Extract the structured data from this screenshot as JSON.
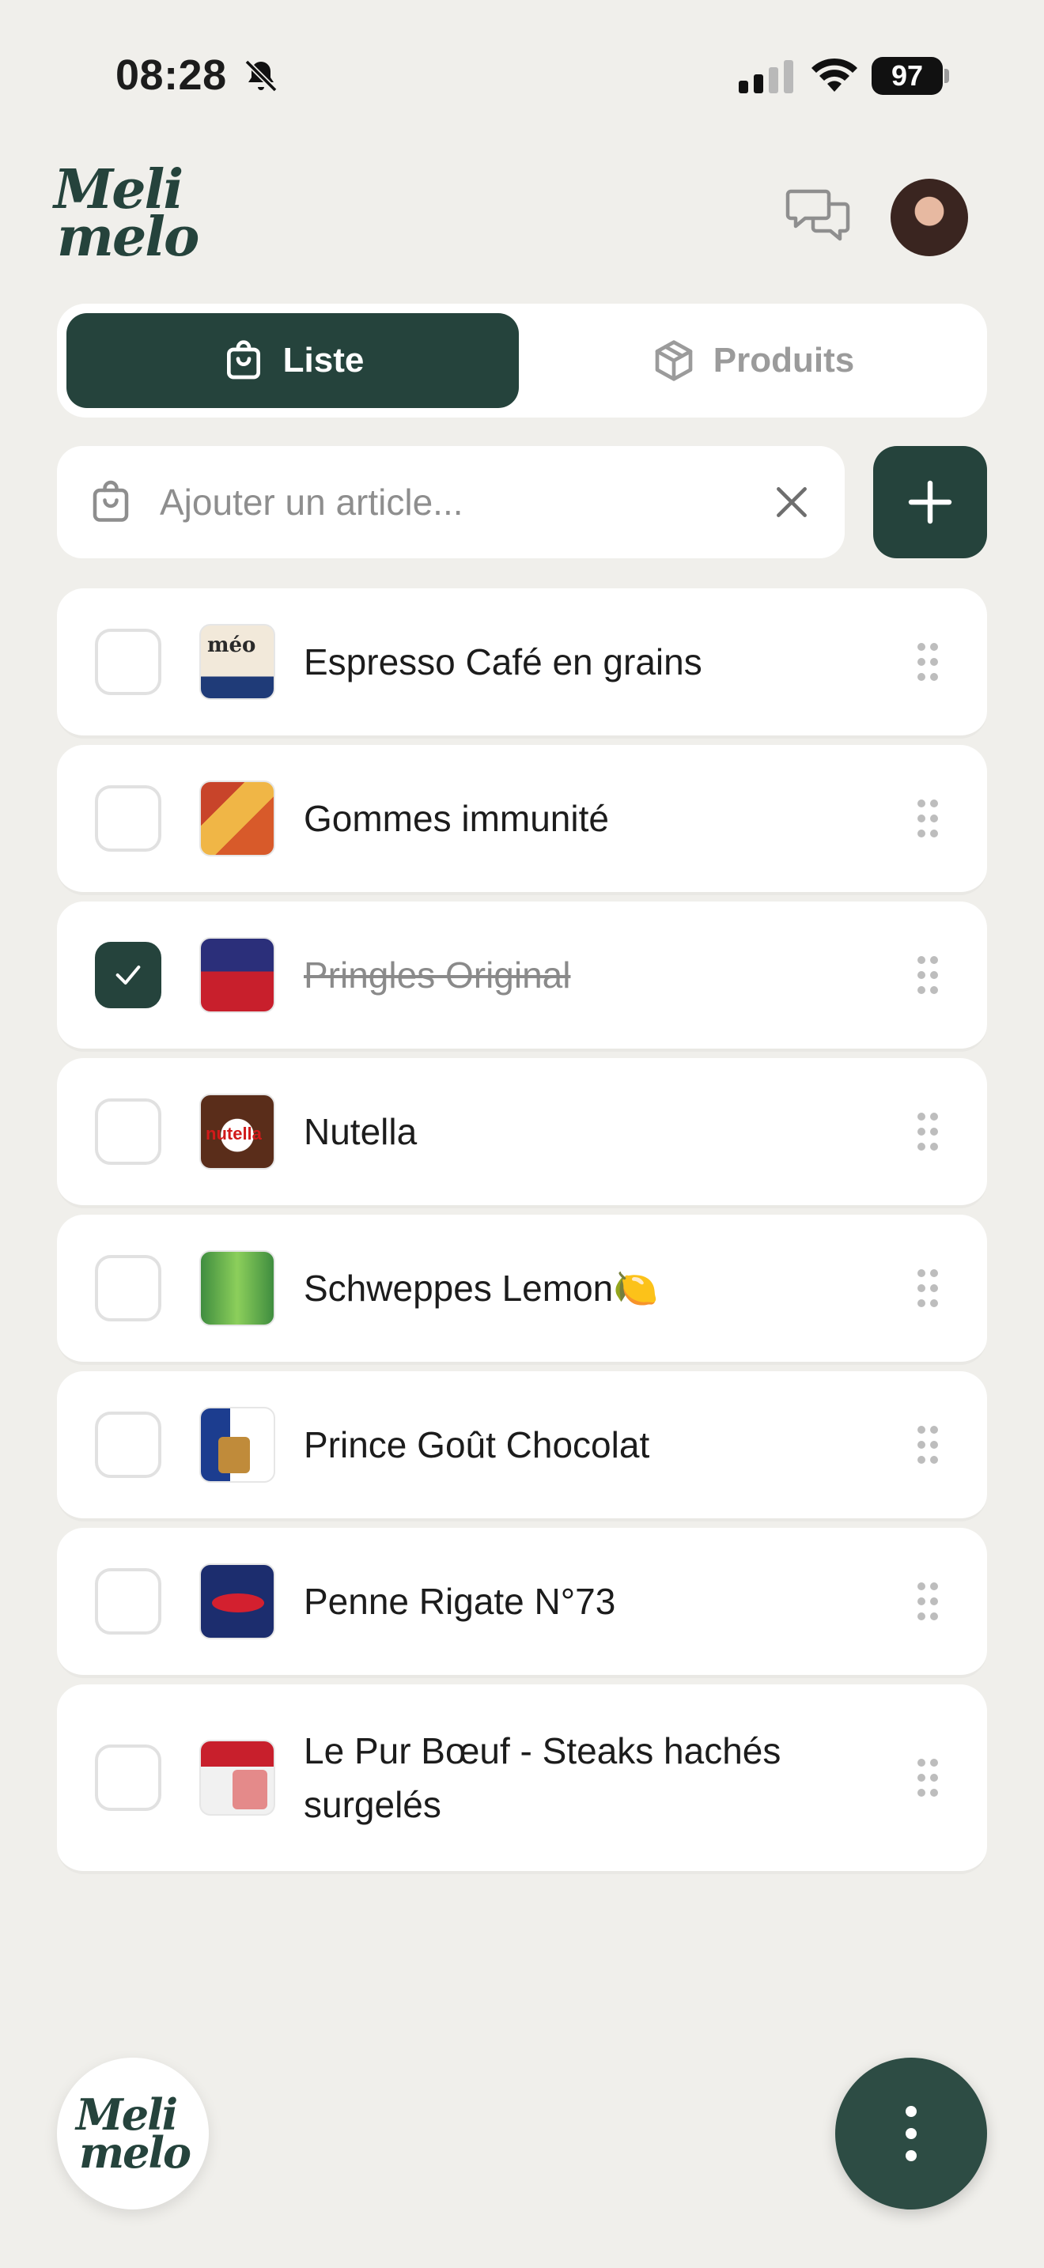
{
  "status_bar": {
    "time": "08:28",
    "battery": "97"
  },
  "header": {
    "logo_line1": "Meli",
    "logo_line2": "melo"
  },
  "tabs": [
    {
      "label": "Liste",
      "active": true
    },
    {
      "label": "Produits",
      "active": false
    }
  ],
  "add_item": {
    "placeholder": "Ajouter un article..."
  },
  "items": [
    {
      "name": "Espresso Café en grains",
      "checked": false,
      "thumb_text": "méo"
    },
    {
      "name": "Gommes immunité",
      "checked": false
    },
    {
      "name": "Pringles Original",
      "checked": true
    },
    {
      "name": "Nutella",
      "checked": false,
      "thumb_text": "nutella"
    },
    {
      "name": "Schweppes Lemon🍋",
      "checked": false
    },
    {
      "name": "Prince Goût Chocolat",
      "checked": false
    },
    {
      "name": "Penne Rigate N°73",
      "checked": false
    },
    {
      "name": "Le Pur Bœuf - Steaks hachés surgelés",
      "checked": false
    }
  ],
  "fab": {
    "logo_line1": "Meli",
    "logo_line2": "melo"
  },
  "colors": {
    "accent": "#25433c",
    "background": "#f0efeb",
    "card": "#ffffff"
  }
}
